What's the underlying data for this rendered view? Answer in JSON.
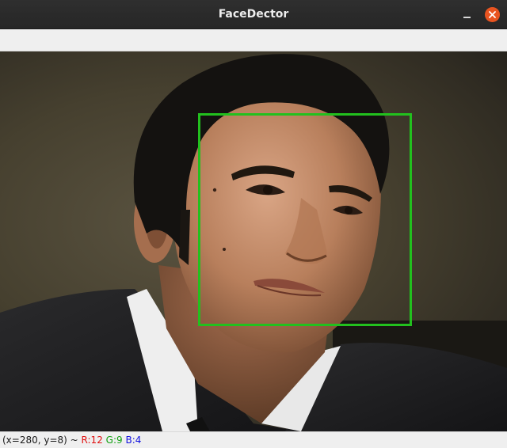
{
  "window": {
    "title": "FaceDector"
  },
  "colors": {
    "detection_box": "#22c01e",
    "close_button": "#e95420",
    "status_r": "#e01010",
    "status_g": "#10a010",
    "status_b": "#1010e0"
  },
  "icons": {
    "minimize": "minimize-icon",
    "close": "close-icon"
  },
  "status": {
    "coords": "(x=280, y=8) ~",
    "r": "R:12",
    "g": "G:9",
    "b": "B:4"
  }
}
